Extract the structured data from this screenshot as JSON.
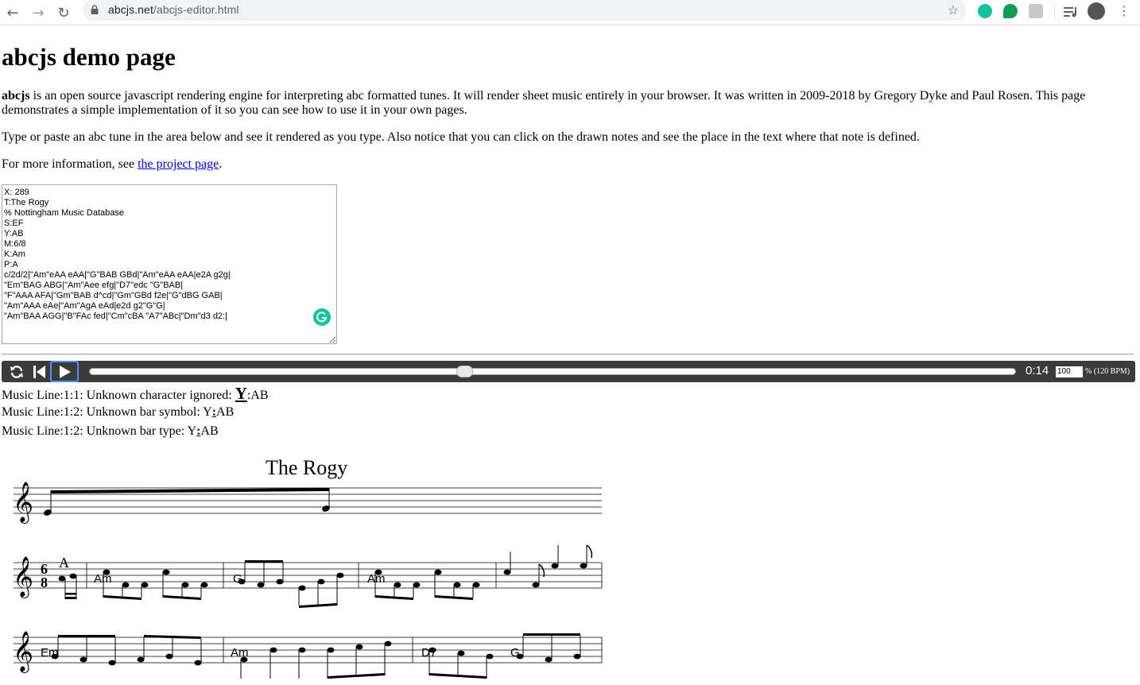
{
  "browser": {
    "url_domain": "abcjs.net",
    "url_path": "/abcjs-editor.html"
  },
  "page": {
    "title": "abcjs demo page",
    "intro_bold": "abcjs",
    "intro_rest": " is an open source javascript rendering engine for interpreting abc formatted tunes. It will render sheet music entirely in your browser. It was written in 2009-2018 by Gregory Dyke and Paul Rosen. This page demonstrates a simple implementation of it so you can see how to use it in your own pages.",
    "instructions": "Type or paste an abc tune in the area below and see it rendered as you type. Also notice that you can click on the drawn notes and see the place in the text where that note is defined.",
    "more_info_prefix": "For more information, see ",
    "more_info_link": "the project page",
    "more_info_suffix": "."
  },
  "editor": {
    "abc_text": "X: 289\nT:The Rogy\n% Nottingham Music Database\nS:EF\nY:AB\nM:6/8\nK:Am\nP:A\nc/2d/2|\"Am\"eAA eAA|\"G\"BAB GBd|\"Am\"eAA eAA|e2A g2g|\n\"Em\"BAG ABG|\"Am\"Aee efg|\"D7\"edc \"G\"BAB|\n\"F\"AAA AFA|\"Gm\"BAB d^cd|\"Gm\"GBd f2e|\"G\"dBG GAB|\n\"Am\"AAA eAe|\"Am\"AgA eAd|e2d g2\"G\"G|\n\"Am\"BAA AGG|\"B\"FAc fed|\"Cm\"cBA \"A7\"ABc|\"Dm\"d3 d2:|"
  },
  "player": {
    "time": "0:14",
    "tempo_value": "100",
    "tempo_label": "% (120 BPM)",
    "progress": 0.405
  },
  "warnings": [
    {
      "prefix": "Music Line:1:1: Unknown character ignored: ",
      "highlight": "Y",
      "suffix": ":AB"
    },
    {
      "prefix": "Music Line:1:2: Unknown bar symbol: Y",
      "highlight": ":",
      "suffix": "AB"
    },
    {
      "prefix": "Music Line:1:2: Unknown bar type: Y",
      "highlight": ":",
      "suffix": "AB"
    }
  ],
  "score": {
    "title": "The Rogy",
    "part_label": "A",
    "time_signature_top": "6",
    "time_signature_bottom": "8",
    "line2_chords": [
      "Am",
      "G",
      "Am"
    ],
    "line3_chords": [
      "Em",
      "Am",
      "D7",
      "G"
    ]
  }
}
